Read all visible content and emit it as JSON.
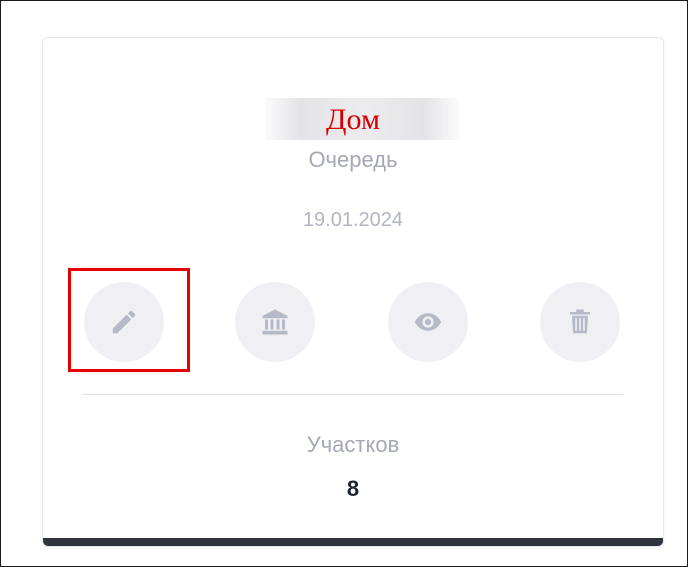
{
  "card": {
    "title": "Дом",
    "subtitle": "Очередь",
    "date": "19.01.2024",
    "stat_label": "Участков",
    "stat_value": "8"
  },
  "actions": [
    {
      "icon": "pencil-icon",
      "name": "edit-button"
    },
    {
      "icon": "bank-icon",
      "name": "bank-button"
    },
    {
      "icon": "eye-icon",
      "name": "view-button"
    },
    {
      "icon": "trash-icon",
      "name": "delete-button"
    }
  ],
  "colors": {
    "title": "#d40000",
    "muted_text": "#a5a8b5",
    "icon": "#b6b9c6",
    "icon_bg": "#f0f0f4",
    "highlight": "#e60000",
    "bottom_bar": "#2f333d"
  }
}
